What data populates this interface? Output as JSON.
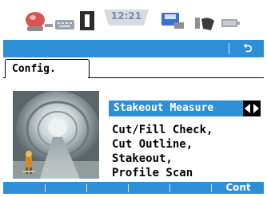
{
  "status_bar": {
    "clock": "12:21",
    "icons": [
      "satellite-icon",
      "keyboard-icon",
      "memory-card-icon",
      "clock-icon",
      "disk-icon",
      "mouse-icon",
      "battery-icon"
    ]
  },
  "top_bar": {
    "undo_label": "⮌",
    "accent": "#2f8fd6"
  },
  "tabs": [
    {
      "label": "Config."
    }
  ],
  "main": {
    "stakeout_selector": "Stakeout Measure",
    "description_lines": [
      "Cut/Fill Check,",
      "Cut Outline,",
      "Stakeout,",
      "Profile Scan"
    ]
  },
  "softkeys": {
    "cont_label": "Cont"
  }
}
